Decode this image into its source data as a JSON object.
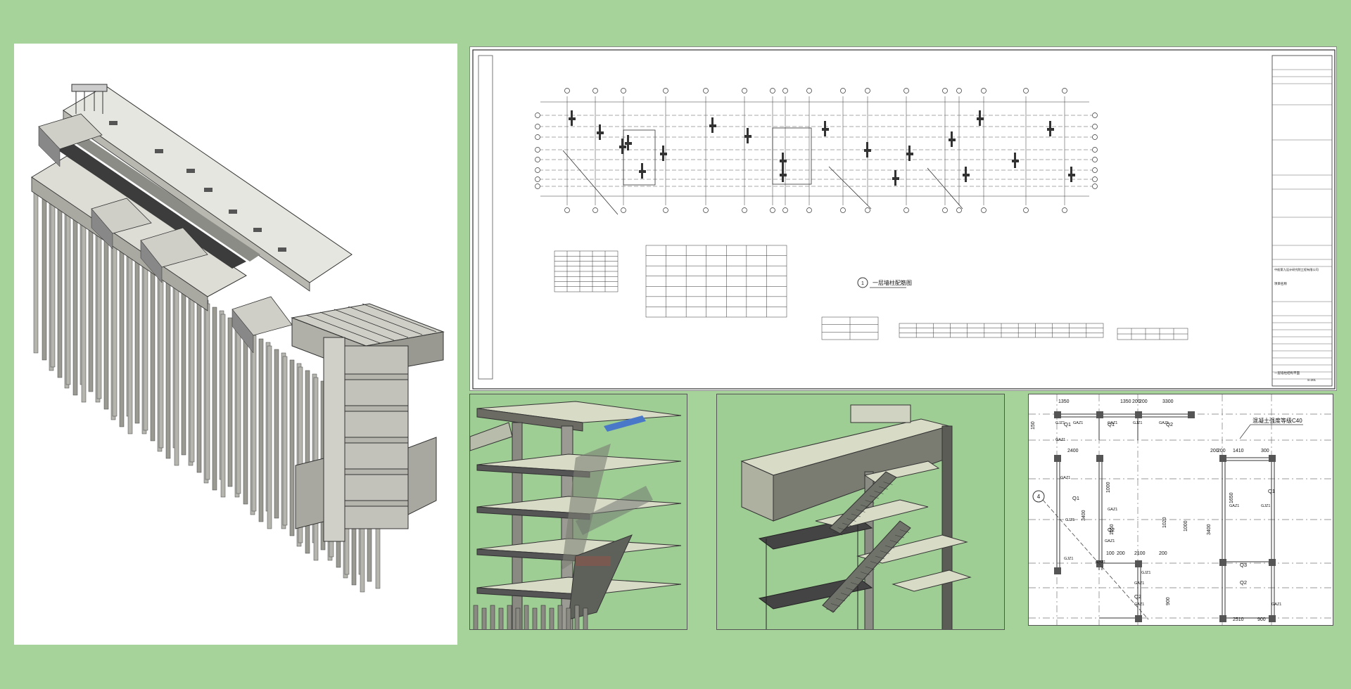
{
  "colors": {
    "background": "#a6d39a",
    "panel": "#ffffff",
    "concrete_light": "#e6e6e0",
    "concrete_mid": "#c8c8c0",
    "concrete_dark": "#8f8f88",
    "stair_blue": "#4a78c9",
    "render_slab": "#d8dbc6",
    "line_dark": "#222222"
  },
  "plan_sheet": {
    "drawing_title": "一层墙柱配筋图",
    "drawing_number": "1",
    "title_block": {
      "company_line": "中船第九设计研究院工程有限公司",
      "project": "项目名称",
      "sheet_title": "一层墙柱结构平面",
      "sheet_number": "S-201"
    }
  },
  "detail_sheet": {
    "dimensions_top": [
      "1350",
      "1350",
      "200",
      "200",
      "3300"
    ],
    "dimensions_mid": [
      "2400",
      "200",
      "200",
      "1410",
      "300"
    ],
    "dimensions_bottom": [
      "100",
      "200",
      "2100",
      "200",
      "2510",
      "900"
    ],
    "dimensions_vertical": [
      "150",
      "1000",
      "1650",
      "3400",
      "1650",
      "3400",
      "900",
      "1020",
      "1000"
    ],
    "note": "混凝土强度等级C40",
    "labels": [
      "Q1",
      "Q1",
      "Q2",
      "Q1",
      "Q2",
      "Q3",
      "Q2",
      "Q2",
      "Q1"
    ],
    "tags": [
      "GJZ1",
      "GAZ1",
      "GAZ1",
      "GJZ1",
      "GAZ1",
      "GAZ1",
      "GAZ1",
      "GJZ1",
      "GAZ1",
      "GAZ1",
      "GYZ1",
      "GJZ1",
      "GAZ1",
      "GJZ1",
      "GAZ1",
      "GAZ1",
      "GJZ1",
      "GAZ1"
    ],
    "axis_bubble": "4"
  }
}
